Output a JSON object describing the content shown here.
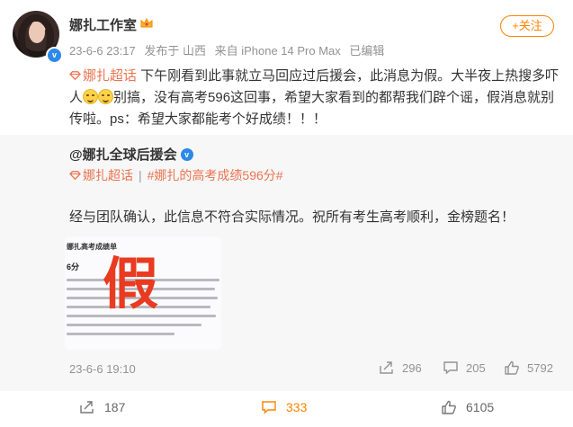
{
  "author": {
    "name": "娜扎工作室",
    "verified_mark": "v",
    "timestamp": "23-6-6 23:17",
    "location": "发布于 山西",
    "device": "来自 iPhone 14 Pro Max",
    "edited": "已编辑"
  },
  "follow_button": "+关注",
  "content": {
    "supertopic": "娜扎超话",
    "text1": " 下午刚看到此事就立马回应过后援会，此消息为假。大半夜上热搜多吓人",
    "text2": "别搞，没有高考596这回事，希望大家看到的都帮我们辟个谣，假消息就别传啦。ps：希望大家都能考个好成绩！！！"
  },
  "repost": {
    "author": "@娜扎全球后援会",
    "verified_mark": "v",
    "supertopic": "娜扎超话",
    "separator": "|",
    "hashtag": "#娜扎的高考成绩596分#",
    "text": "经与团队确认，此信息不符合实际情况。祝所有考生高考顺利，金榜题名！",
    "image": {
      "title": "娜扎高考成绩单",
      "score": "6分",
      "stamp": "假"
    },
    "timestamp": "23-6-6 19:10",
    "reposts": "296",
    "comments": "205",
    "likes": "5792"
  },
  "footer": {
    "reposts": "187",
    "comments": "333",
    "likes": "6105"
  },
  "colors": {
    "accent": "#ff8200",
    "link": "#eb7350",
    "verified": "#2c89e8",
    "repost_bg": "#f7f7f7"
  },
  "icons": [
    "crown-icon",
    "supertopic-diamond-icon",
    "grin-emoji-icon",
    "repost-icon",
    "comment-icon",
    "like-icon"
  ]
}
